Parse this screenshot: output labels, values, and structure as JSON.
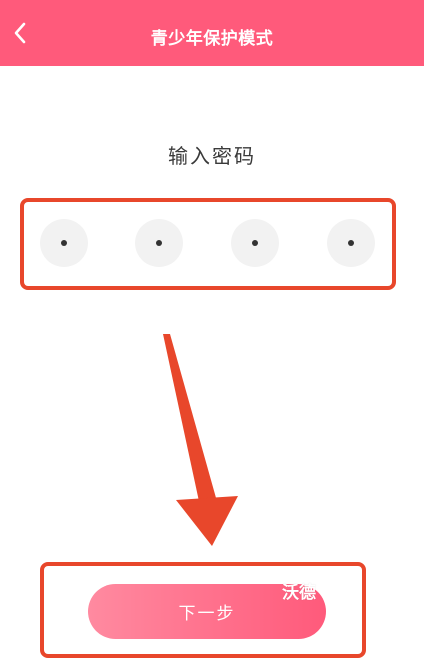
{
  "header": {
    "title": "青少年保护模式",
    "back_icon": "chevron-left-icon",
    "background": "#ff5a7b"
  },
  "prompt": {
    "text": "输入密码"
  },
  "pin": {
    "digits_entered": 4,
    "mask_char": "•"
  },
  "actions": {
    "next_label": "下一步"
  },
  "watermark": {
    "text": "沃德"
  },
  "colors": {
    "accent": "#ff5a7b",
    "annotation": "#e8472b"
  }
}
